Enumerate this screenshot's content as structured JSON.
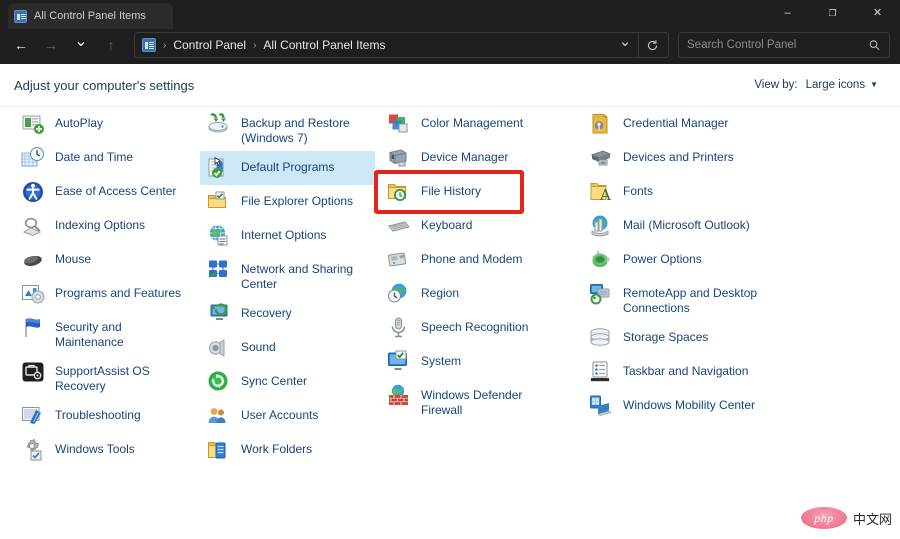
{
  "window": {
    "tab_title": "All Control Panel Items",
    "tab_icon": "control-panel-icon",
    "minimize_glyph": "–",
    "maximize_glyph": "❐",
    "close_glyph": "✕"
  },
  "navigation": {
    "back_glyph": "←",
    "forward_glyph": "→",
    "recent_glyph": "⌄",
    "up_glyph": "↑"
  },
  "address": {
    "crumbs": [
      "Control Panel",
      "All Control Panel Items"
    ],
    "separator": "›",
    "chevron_glyph": "⌄",
    "refresh_icon": "refresh-icon"
  },
  "search": {
    "placeholder": "Search Control Panel",
    "value": "",
    "icon": "search-icon"
  },
  "header": {
    "heading": "Adjust your computer's settings",
    "view_by_label": "View by:",
    "view_by_value": "Large icons",
    "view_by_caret": "▼"
  },
  "highlight": {
    "target": "File History",
    "color": "#e8221c"
  },
  "hovered_item": "Default Programs",
  "watermark": {
    "logo_text": "php",
    "text": "中文网"
  },
  "columns": [
    {
      "items": [
        {
          "label": "AutoPlay",
          "icon": "autoplay-icon"
        },
        {
          "label": "Date and Time",
          "icon": "date-and-time-icon"
        },
        {
          "label": "Ease of Access Center",
          "icon": "ease-of-access-center-icon"
        },
        {
          "label": "Indexing Options",
          "icon": "indexing-options-icon"
        },
        {
          "label": "Mouse",
          "icon": "mouse-icon"
        },
        {
          "label": "Programs and Features",
          "icon": "programs-and-features-icon"
        },
        {
          "label": "Security and Maintenance",
          "icon": "security-and-maintenance-icon"
        },
        {
          "label": "SupportAssist OS\nRecovery",
          "icon": "supportassist-os-recovery-icon"
        },
        {
          "label": "Troubleshooting",
          "icon": "troubleshooting-icon"
        },
        {
          "label": "Windows Tools",
          "icon": "windows-tools-icon"
        }
      ]
    },
    {
      "items": [
        {
          "label": "Backup and Restore\n(Windows 7)",
          "icon": "backup-and-restore-icon"
        },
        {
          "label": "Default Programs",
          "icon": "default-programs-icon"
        },
        {
          "label": "File Explorer Options",
          "icon": "file-explorer-options-icon"
        },
        {
          "label": "Internet Options",
          "icon": "internet-options-icon"
        },
        {
          "label": "Network and Sharing\nCenter",
          "icon": "network-and-sharing-center-icon"
        },
        {
          "label": "Recovery",
          "icon": "recovery-icon"
        },
        {
          "label": "Sound",
          "icon": "sound-icon"
        },
        {
          "label": "Sync Center",
          "icon": "sync-center-icon"
        },
        {
          "label": "User Accounts",
          "icon": "user-accounts-icon"
        },
        {
          "label": "Work Folders",
          "icon": "work-folders-icon"
        }
      ]
    },
    {
      "items": [
        {
          "label": "Color Management",
          "icon": "color-management-icon"
        },
        {
          "label": "Device Manager",
          "icon": "device-manager-icon"
        },
        {
          "label": "File History",
          "icon": "file-history-icon"
        },
        {
          "label": "Keyboard",
          "icon": "keyboard-icon"
        },
        {
          "label": "Phone and Modem",
          "icon": "phone-and-modem-icon"
        },
        {
          "label": "Region",
          "icon": "region-icon"
        },
        {
          "label": "Speech Recognition",
          "icon": "speech-recognition-icon"
        },
        {
          "label": "System",
          "icon": "system-icon"
        },
        {
          "label": "Windows Defender\nFirewall",
          "icon": "windows-defender-firewall-icon"
        }
      ]
    },
    {
      "items": [
        {
          "label": "Credential Manager",
          "icon": "credential-manager-icon"
        },
        {
          "label": "Devices and Printers",
          "icon": "devices-and-printers-icon"
        },
        {
          "label": "Fonts",
          "icon": "fonts-icon"
        },
        {
          "label": "Mail (Microsoft Outlook)",
          "icon": "mail-icon"
        },
        {
          "label": "Power Options",
          "icon": "power-options-icon"
        },
        {
          "label": "RemoteApp and Desktop\nConnections",
          "icon": "remoteapp-and-desktop-connections-icon"
        },
        {
          "label": "Storage Spaces",
          "icon": "storage-spaces-icon"
        },
        {
          "label": "Taskbar and Navigation",
          "icon": "taskbar-and-navigation-icon"
        },
        {
          "label": "Windows Mobility Center",
          "icon": "windows-mobility-center-icon"
        }
      ]
    }
  ]
}
